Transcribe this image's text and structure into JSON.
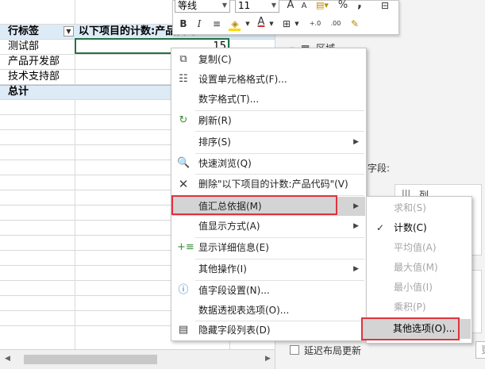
{
  "grid": {
    "header_row_label": "行标签",
    "header_col_label": "以下项目的计数:产品代码",
    "rows": [
      {
        "label": "测试部",
        "value": "15"
      },
      {
        "label": "产品开发部",
        "value": ""
      },
      {
        "label": "技术支持部",
        "value": ""
      }
    ],
    "total_label": "总计"
  },
  "mini_toolbar": {
    "font_name": "等线",
    "font_size": "11",
    "increase_font": "A",
    "decrease_font": "A",
    "percent": "%",
    "comma": ",",
    "bold": "B",
    "italic": "I",
    "font_color_letter": "A"
  },
  "context_menu": {
    "items": [
      {
        "label": "复制(C)",
        "icon": "copy-icon"
      },
      {
        "label": "设置单元格格式(F)...",
        "icon": "format-cells-icon"
      },
      {
        "label": "数字格式(T)...",
        "icon": ""
      },
      {
        "label": "刷新(R)",
        "icon": "refresh-icon"
      },
      {
        "label": "排序(S)",
        "icon": ""
      },
      {
        "label": "快速浏览(Q)",
        "icon": "quick-explore-icon"
      },
      {
        "label": "删除\"以下项目的计数:产品代码\"(V)",
        "icon": "delete-x-icon"
      },
      {
        "label": "值汇总依据(M)",
        "icon": ""
      },
      {
        "label": "值显示方式(A)",
        "icon": ""
      },
      {
        "label": "显示详细信息(E)",
        "icon": "show-details-icon"
      },
      {
        "label": "其他操作(I)",
        "icon": ""
      },
      {
        "label": "值字段设置(N)...",
        "icon": "field-settings-icon"
      },
      {
        "label": "数据透视表选项(O)...",
        "icon": ""
      },
      {
        "label": "隐藏字段列表(D)",
        "icon": "field-list-icon"
      }
    ]
  },
  "submenu": {
    "items": [
      {
        "label": "求和(S)",
        "enabled": false,
        "checked": false
      },
      {
        "label": "计数(C)",
        "enabled": true,
        "checked": true
      },
      {
        "label": "平均值(A)",
        "enabled": false,
        "checked": false
      },
      {
        "label": "最大值(M)",
        "enabled": false,
        "checked": false
      },
      {
        "label": "最小值(I)",
        "enabled": false,
        "checked": false
      },
      {
        "label": "乘积(P)",
        "enabled": false,
        "checked": false
      },
      {
        "label": "其他选项(O)...",
        "enabled": true,
        "checked": false
      }
    ]
  },
  "panel": {
    "area_label": "区域",
    "field_label": "字段:",
    "column_label": "列",
    "defer_label": "延迟布局更新",
    "update_label": "更"
  },
  "colors": {
    "header_fill": "#ddebf7",
    "highlight_box": "#e0323e",
    "selection_border": "#217346"
  }
}
